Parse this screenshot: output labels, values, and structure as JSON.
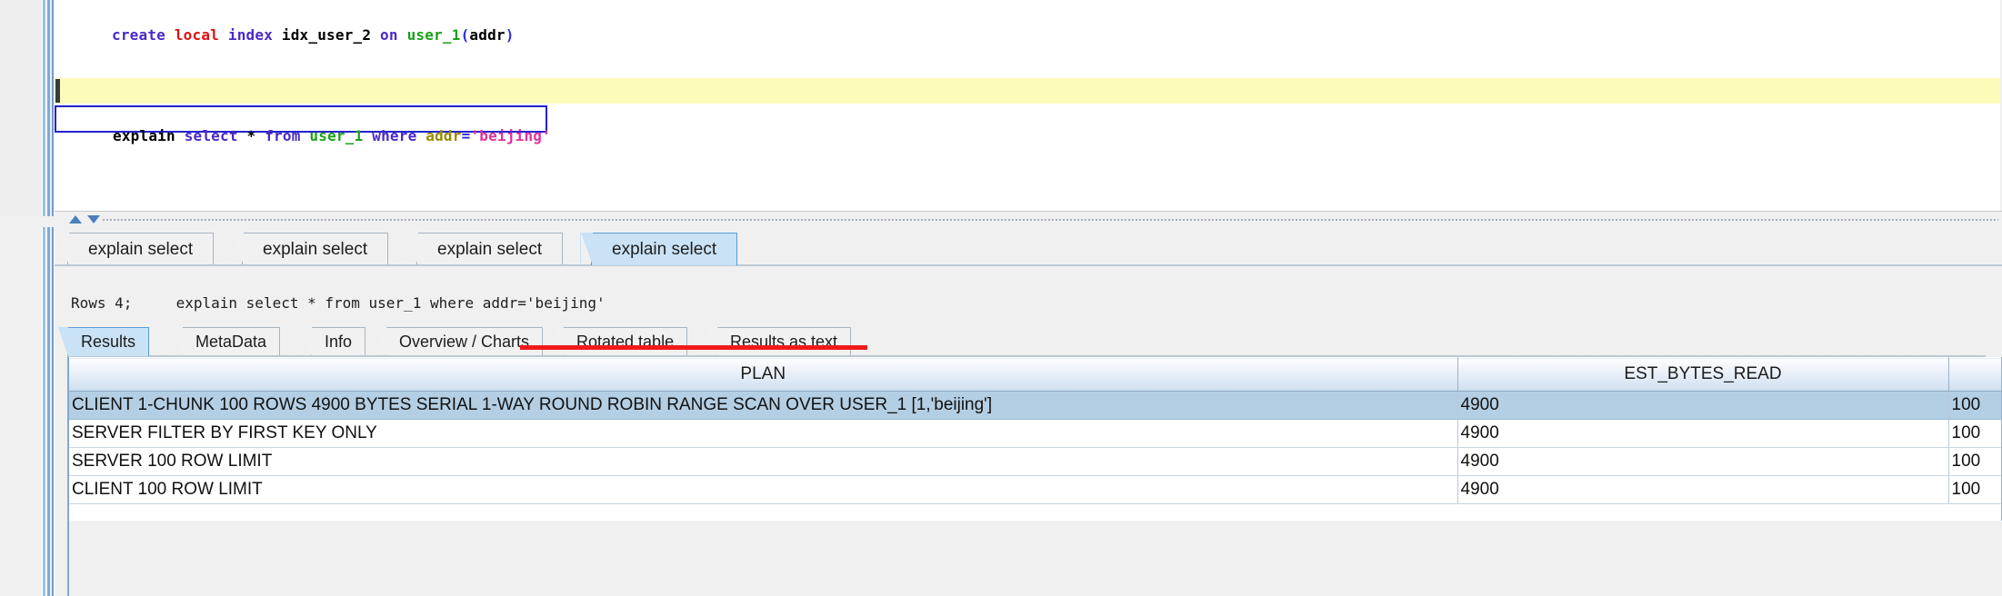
{
  "editor": {
    "statements": [
      {
        "id": "create-index",
        "text": "create local index idx_user_2 on user_1(addr)",
        "tokens": [
          {
            "t": "create",
            "c": "kw"
          },
          {
            "t": " ",
            "c": "ident"
          },
          {
            "t": "local",
            "c": "kw-red"
          },
          {
            "t": " ",
            "c": "ident"
          },
          {
            "t": "index",
            "c": "kw"
          },
          {
            "t": " ",
            "c": "ident"
          },
          {
            "t": "idx_user_2",
            "c": "ident"
          },
          {
            "t": " ",
            "c": "ident"
          },
          {
            "t": "on",
            "c": "kw"
          },
          {
            "t": " ",
            "c": "ident"
          },
          {
            "t": "user_1",
            "c": "tbl"
          },
          {
            "t": "(",
            "c": "punct"
          },
          {
            "t": "addr",
            "c": "ident"
          },
          {
            "t": ")",
            "c": "punct"
          }
        ]
      },
      {
        "id": "explain-select",
        "text": "explain select * from user_1 where addr='beijing'",
        "tokens": [
          {
            "t": "explain",
            "c": "ident"
          },
          {
            "t": " ",
            "c": "ident"
          },
          {
            "t": "select",
            "c": "kw"
          },
          {
            "t": " ",
            "c": "ident"
          },
          {
            "t": "*",
            "c": "ident"
          },
          {
            "t": " ",
            "c": "ident"
          },
          {
            "t": "from",
            "c": "kw"
          },
          {
            "t": " ",
            "c": "ident"
          },
          {
            "t": "user_1",
            "c": "tbl"
          },
          {
            "t": " ",
            "c": "ident"
          },
          {
            "t": "where",
            "c": "kw"
          },
          {
            "t": " ",
            "c": "ident"
          },
          {
            "t": "addr",
            "c": "col"
          },
          {
            "t": "=",
            "c": "op"
          },
          {
            "t": "'beijing'",
            "c": "str"
          }
        ]
      }
    ]
  },
  "splitter": {
    "collapse_up_icon": "triangle-up-icon",
    "collapse_down_icon": "triangle-down-icon"
  },
  "result_tabs": {
    "items": [
      {
        "label": "explain select",
        "active": false
      },
      {
        "label": "explain select",
        "active": false
      },
      {
        "label": "explain select",
        "active": false
      },
      {
        "label": "explain select",
        "active": true
      }
    ]
  },
  "summary": {
    "rows_label": "Rows 4;",
    "query": "explain select * from user_1 where addr='beijing'",
    "full": "Rows 4;     explain select * from user_1 where addr='beijing'"
  },
  "view_tabs": {
    "items": [
      {
        "label": "Results",
        "active": true
      },
      {
        "label": "MetaData",
        "active": false
      },
      {
        "label": "Info",
        "active": false
      },
      {
        "label": "Overview / Charts",
        "active": false
      },
      {
        "label": "Rotated table",
        "active": false
      },
      {
        "label": "Results as text",
        "active": false
      }
    ]
  },
  "results_grid": {
    "columns": [
      "PLAN",
      "EST_BYTES_READ",
      ""
    ],
    "rows": [
      {
        "plan": "CLIENT 1-CHUNK 100 ROWS 4900 BYTES SERIAL 1-WAY ROUND ROBIN RANGE SCAN OVER USER_1 [1,'beijing']",
        "est_bytes_read": "4900",
        "third": "100",
        "indent": 0,
        "selected": true
      },
      {
        "plan": "SERVER FILTER BY FIRST KEY ONLY",
        "est_bytes_read": "4900",
        "third": "100",
        "indent": 1,
        "selected": false
      },
      {
        "plan": "SERVER 100 ROW LIMIT",
        "est_bytes_read": "4900",
        "third": "100",
        "indent": 1,
        "selected": false
      },
      {
        "plan": "CLIENT 100 ROW LIMIT",
        "est_bytes_read": "4900",
        "third": "100",
        "indent": 0,
        "selected": false
      }
    ]
  },
  "annotation": {
    "underline_color": "#f21a1a",
    "target_text": "RANGE SCAN OVER USER_1 [1,'beijing']"
  },
  "colors": {
    "selection": "#b4cfe4",
    "active_tab": "#c9e2f6",
    "current_line": "#fdfbb9",
    "focus_border": "#2222cc"
  }
}
